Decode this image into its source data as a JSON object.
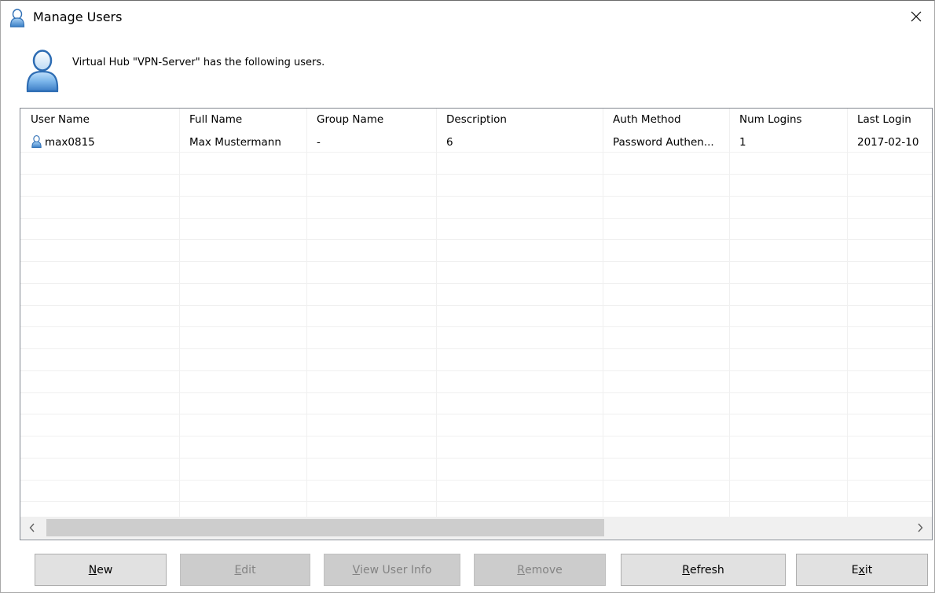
{
  "window": {
    "title": "Manage Users",
    "close_glyph": "✕"
  },
  "header": {
    "message": "Virtual Hub \"VPN-Server\" has the following users."
  },
  "list": {
    "columns": [
      "User Name",
      "Full Name",
      "Group Name",
      "Description",
      "Auth Method",
      "Num Logins",
      "Last Login"
    ],
    "rows": [
      {
        "user_name": "max0815",
        "full_name": "Max Mustermann",
        "group_name": "-",
        "description": "6",
        "auth_method": "Password Authen...",
        "num_logins": "1",
        "last_login": "2017-02-10"
      }
    ]
  },
  "scrollbar": {
    "left_arrow": "<",
    "right_arrow": ">"
  },
  "buttons": {
    "new": {
      "mnemonic": "N",
      "rest": "ew",
      "enabled": true
    },
    "edit": {
      "mnemonic": "E",
      "rest": "dit",
      "enabled": false
    },
    "view_user_info": {
      "mnemonic": "V",
      "rest": "iew User Info",
      "enabled": false
    },
    "remove": {
      "mnemonic": "R",
      "rest": "emove",
      "enabled": false
    },
    "refresh": {
      "mnemonic": "R",
      "rest": "efresh",
      "enabled": true
    },
    "exit": {
      "pre": "E",
      "mnemonic": "x",
      "rest": "it",
      "enabled": true
    }
  },
  "icons": {
    "title": "user-icon",
    "header": "user-large-icon",
    "row": "user-icon",
    "close": "close-icon"
  },
  "colors": {
    "icon_blue": "#4a8fd1",
    "disabled_text": "#838383",
    "button_face": "#e1e1e1",
    "scroll_thumb": "#cdcdcd"
  }
}
